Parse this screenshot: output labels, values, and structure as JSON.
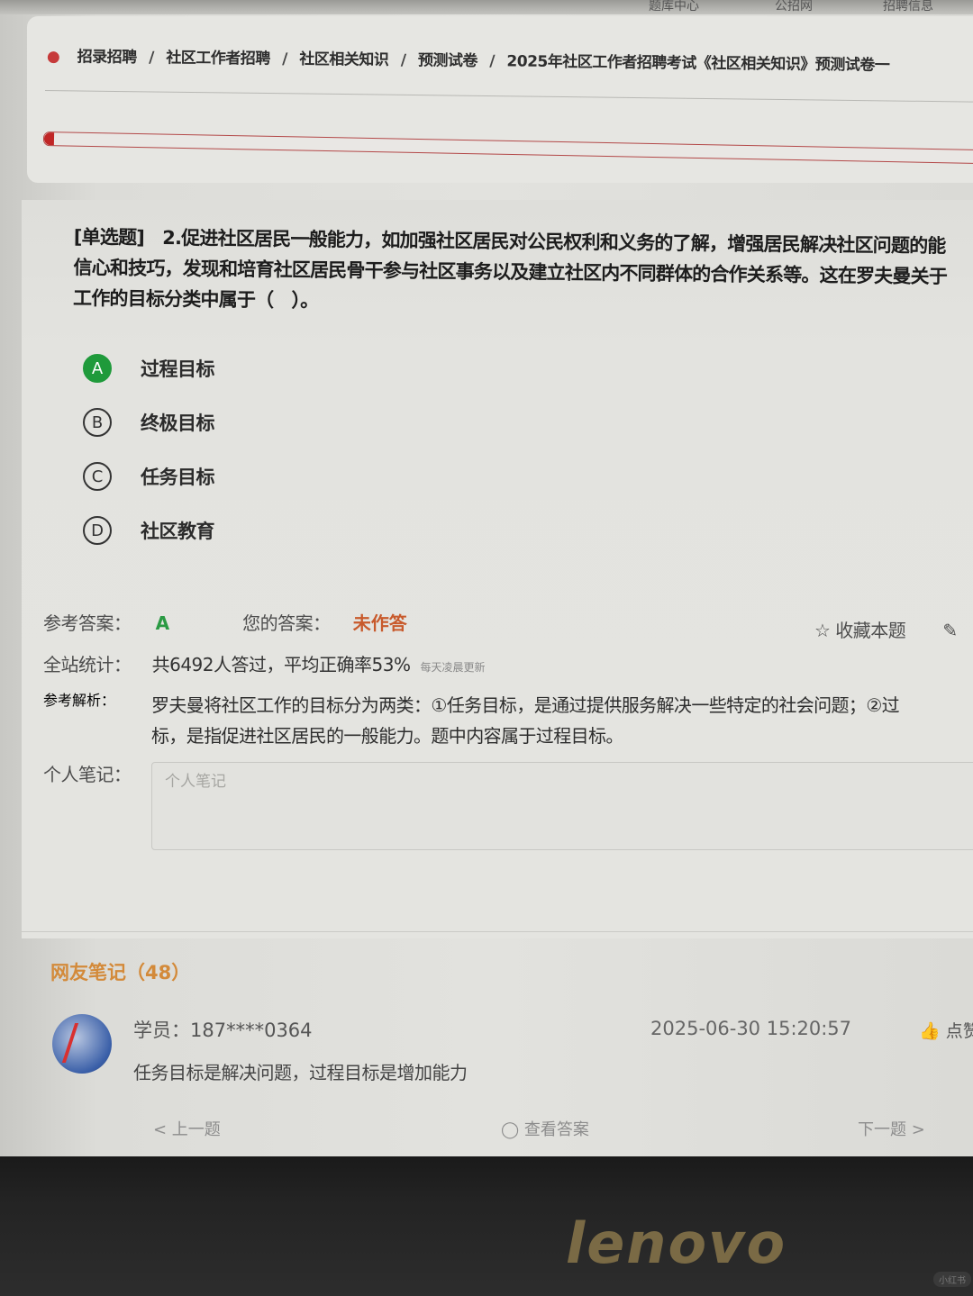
{
  "topbar": {
    "items": [
      "题库中心",
      "公招网",
      "招聘信息"
    ]
  },
  "breadcrumb": {
    "items": [
      "招录招聘",
      "社区工作者招聘",
      "社区相关知识",
      "预测试卷",
      "2025年社区工作者招聘考试《社区相关知识》预测试卷一"
    ],
    "separator": "/"
  },
  "progress": {
    "fraction": 0.01
  },
  "question": {
    "line1": "[单选题]　2.促进社区居民一般能力，如加强社区居民对公民权利和义务的了解，增强居民解决社区问题的能",
    "line2": "信心和技巧，发现和培育社区居民骨干参与社区事务以及建立社区内不同群体的合作关系等。这在罗夫曼关于",
    "line3": "工作的目标分类中属于（　）。",
    "options": [
      {
        "letter": "A",
        "text": "过程目标",
        "selected": true
      },
      {
        "letter": "B",
        "text": "终极目标",
        "selected": false
      },
      {
        "letter": "C",
        "text": "任务目标",
        "selected": false
      },
      {
        "letter": "D",
        "text": "社区教育",
        "selected": false
      }
    ]
  },
  "answer": {
    "ref_label": "参考答案：",
    "ref_value": "A",
    "yours_label": "您的答案：",
    "yours_value": "未作答",
    "favorite": "☆ 收藏本题",
    "stats_label": "全站统计：",
    "stats_value": "共6492人答过，平均正确率53%",
    "stats_note": "每天凌晨更新",
    "expl_label": "参考解析：",
    "expl_line1": "罗夫曼将社区工作的目标分为两类：①任务目标，是通过提供服务解决一些特定的社会问题；②过",
    "expl_line2": "标，是指促进社区居民的一般能力。题中内容属于过程目标。",
    "note_label": "个人笔记：",
    "note_placeholder": "个人笔记"
  },
  "comments": {
    "title": "网友笔记（48）",
    "items": [
      {
        "user": "学员：187****0364",
        "date": "2025-06-30 15:20:57",
        "like": "点赞",
        "text": "任务目标是解决问题，过程目标是增加能力"
      }
    ]
  },
  "nav": {
    "prev": "< 上一题",
    "answer": "◯ 查看答案",
    "next": "下一题 >"
  },
  "device": {
    "logo": "lenovo"
  },
  "watermark": "小红书"
}
